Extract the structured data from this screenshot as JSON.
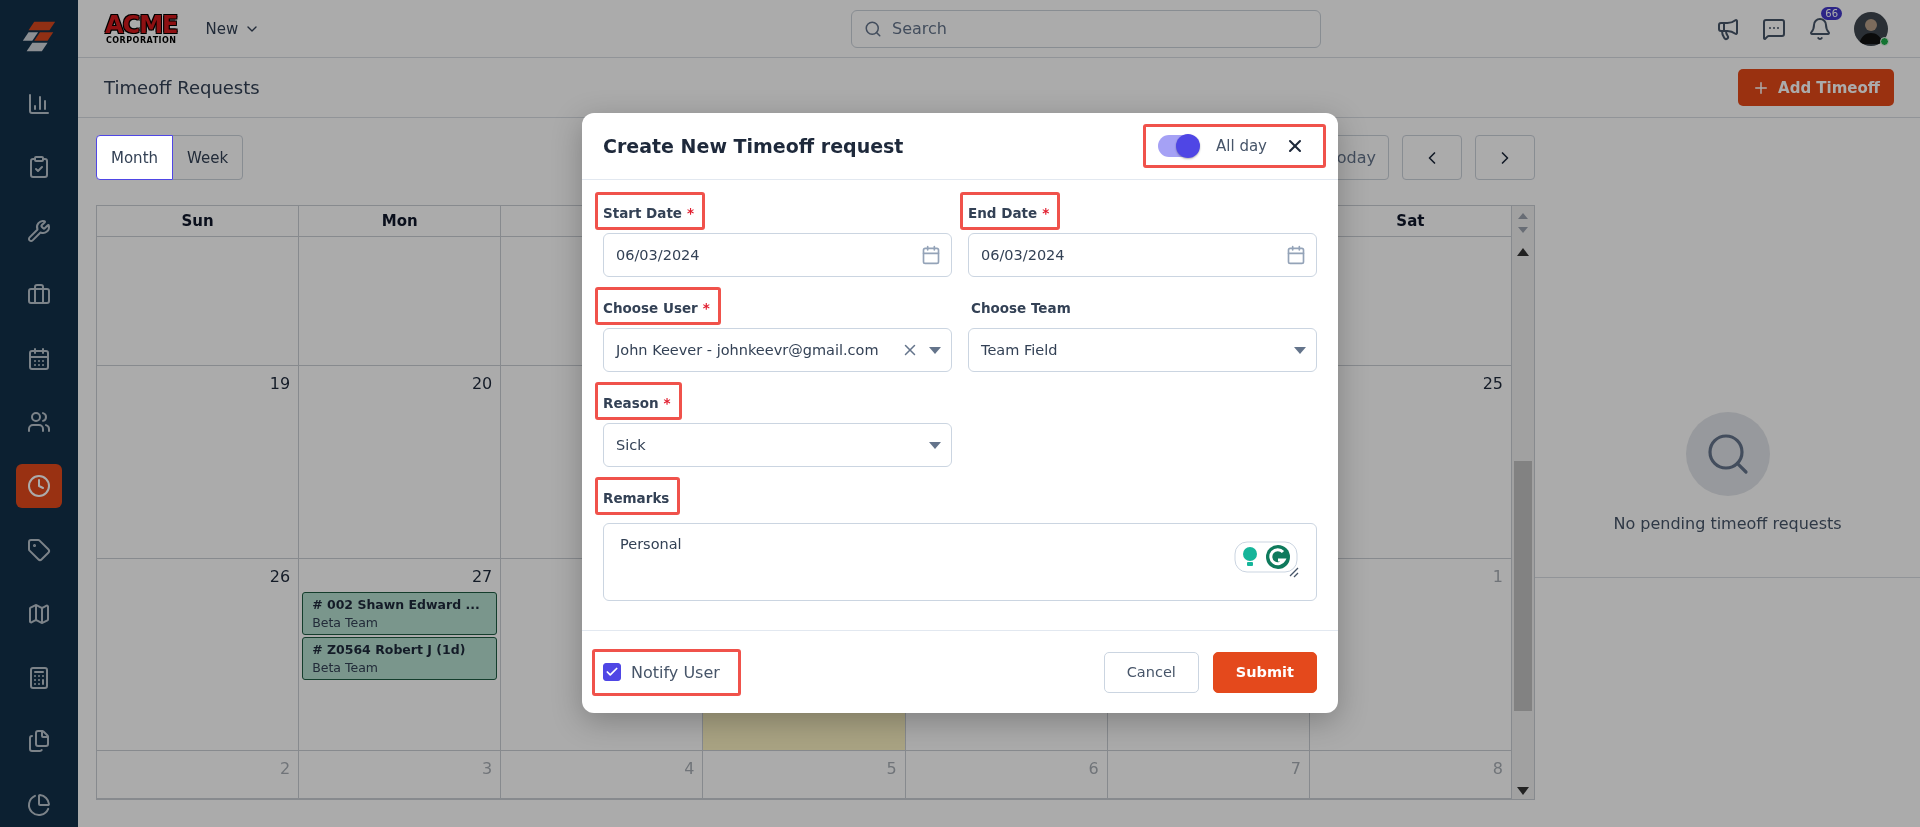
{
  "sidebar": {
    "items": [
      {
        "selected": false
      },
      {
        "selected": false
      },
      {
        "selected": false
      },
      {
        "selected": false
      },
      {
        "selected": false
      },
      {
        "selected": false
      },
      {
        "selected": true
      },
      {
        "selected": false
      },
      {
        "selected": false
      },
      {
        "selected": false
      },
      {
        "selected": false
      },
      {
        "selected": false
      }
    ]
  },
  "header": {
    "logo": {
      "name": "ACME",
      "tagline": "CORPORATION"
    },
    "menu": "New",
    "search": {
      "placeholder": "Search"
    },
    "notifications": "66"
  },
  "page": {
    "title": "Timeoff Requests",
    "add_button": "Add Timeoff"
  },
  "view_tabs": [
    {
      "label": "Month",
      "selected": true
    },
    {
      "label": "Week",
      "selected": false
    }
  ],
  "nav": {
    "today": "oday"
  },
  "calendar": {
    "weekdays": {
      "sun": "Sun",
      "mon": "Mon",
      "sat": "Sat"
    },
    "weeks": [
      {
        "sun": {
          "day": "19",
          "outside_month": false
        },
        "mon": {
          "day": "20",
          "outside_month": false
        },
        "sat": {
          "day": "25",
          "outside_month": false
        }
      },
      {
        "sun": {
          "day": "26",
          "outside_month": false
        },
        "mon": {
          "day": "27",
          "outside_month": false,
          "events": [
            {
              "title": "# 002 Shawn Edward ...",
              "team": "Beta Team"
            },
            {
              "title": "# Z0564 Robert J (1d)",
              "team": "Beta Team"
            }
          ]
        },
        "wed": {
          "today": true
        },
        "sat": {
          "day": "1",
          "outside_month": true
        }
      },
      {
        "sun": {
          "day": "2",
          "outside_month": true
        },
        "mon": {
          "day": "3",
          "outside_month": true
        },
        "tue": {
          "day": "4",
          "outside_month": true
        },
        "wed": {
          "day": "5",
          "outside_month": true
        },
        "thu": {
          "day": "6",
          "outside_month": true
        },
        "fri": {
          "day": "7",
          "outside_month": true
        },
        "sat": {
          "day": "8",
          "outside_month": true
        }
      }
    ]
  },
  "pending": {
    "empty_text": "No pending timeoff requests"
  },
  "modal": {
    "title": "Create New Timeoff request",
    "all_day": {
      "label": "All day",
      "on": true,
      "highlighted": true
    },
    "fields": [
      {
        "kind": "date",
        "label": "Start Date",
        "required_mark": "*",
        "highlighted": true,
        "value": "06/03/2024"
      },
      {
        "kind": "date",
        "label": "End Date",
        "required_mark": "*",
        "highlighted": true,
        "value": "06/03/2024"
      },
      {
        "kind": "select",
        "label": "Choose User",
        "required_mark": "*",
        "highlighted": true,
        "value": "John Keever - johnkeevr@gmail.com",
        "clearable": true
      },
      {
        "kind": "select",
        "label": "Choose Team",
        "highlighted": false,
        "value": "Team Field",
        "clearable": false
      },
      {
        "kind": "select",
        "label": "Reason",
        "required_mark": "*",
        "highlighted": true,
        "value": "Sick",
        "clearable": false
      },
      {
        "kind": "textarea",
        "label": "Remarks",
        "highlighted": true,
        "value": "Personal"
      }
    ],
    "notify": {
      "label": "Notify User",
      "checked": true,
      "highlighted": true
    },
    "buttons": [
      {
        "kind": "secondary",
        "label": "Cancel"
      },
      {
        "kind": "primary",
        "label": "Submit"
      }
    ]
  }
}
